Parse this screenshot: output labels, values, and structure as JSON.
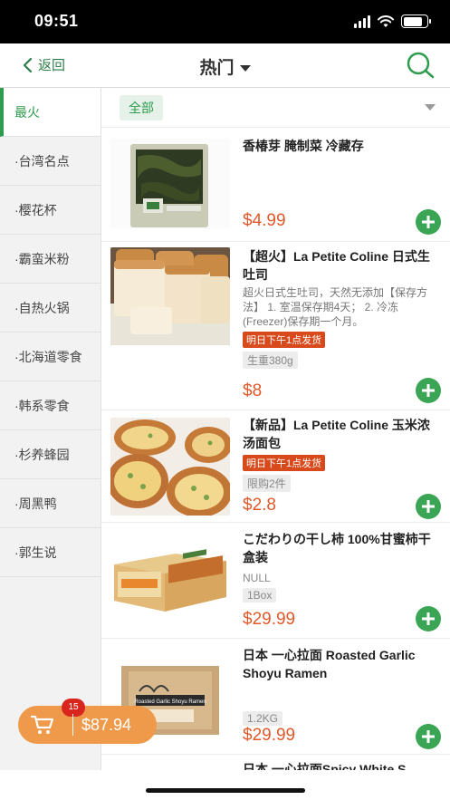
{
  "status": {
    "time": "09:51",
    "battery_level": 0.8
  },
  "nav": {
    "back_label": "返回",
    "title": "热门"
  },
  "sidebar": {
    "items": [
      {
        "label": "最火"
      },
      {
        "label": "·台湾名点"
      },
      {
        "label": "·樱花杯"
      },
      {
        "label": "·霸蛮米粉"
      },
      {
        "label": "·自热火锅"
      },
      {
        "label": "·北海道零食"
      },
      {
        "label": "·韩系零食"
      },
      {
        "label": "·杉养蜂园"
      },
      {
        "label": "·周黑鸭"
      },
      {
        "label": "·郭生说"
      }
    ]
  },
  "filter": {
    "label": "全部"
  },
  "products": [
    {
      "title": "香椿芽 腌制菜 冷藏存",
      "price": "$4.99"
    },
    {
      "title": "【超火】La Petite Coline 日式生吐司",
      "desc": "超火日式生吐司，天然无添加【保存方法】 1. 室温保存期4天； 2. 冷冻(Freezer)保存期一个月。",
      "badge": "明日下午1点发货",
      "spec": "生重380g",
      "price": "$8"
    },
    {
      "title": "【新品】La Petite Coline 玉米浓汤面包",
      "badge": "明日下午1点发货",
      "spec": "限购2件",
      "price": "$2.8"
    },
    {
      "title": "こだわりの干し柿 100%甘蜜柿干 盒装",
      "null_text": "NULL",
      "spec": "1Box",
      "price": "$29.99"
    },
    {
      "title": "日本 一心拉面 Roasted Garlic Shoyu Ramen",
      "spec": "1.2KG",
      "price": "$29.99",
      "package_text": "Roasted Garlic Shoyu Ramen"
    },
    {
      "title": "日本 一心拉面Spicy White S"
    }
  ],
  "cart": {
    "count": "15",
    "total": "$87.94"
  }
}
